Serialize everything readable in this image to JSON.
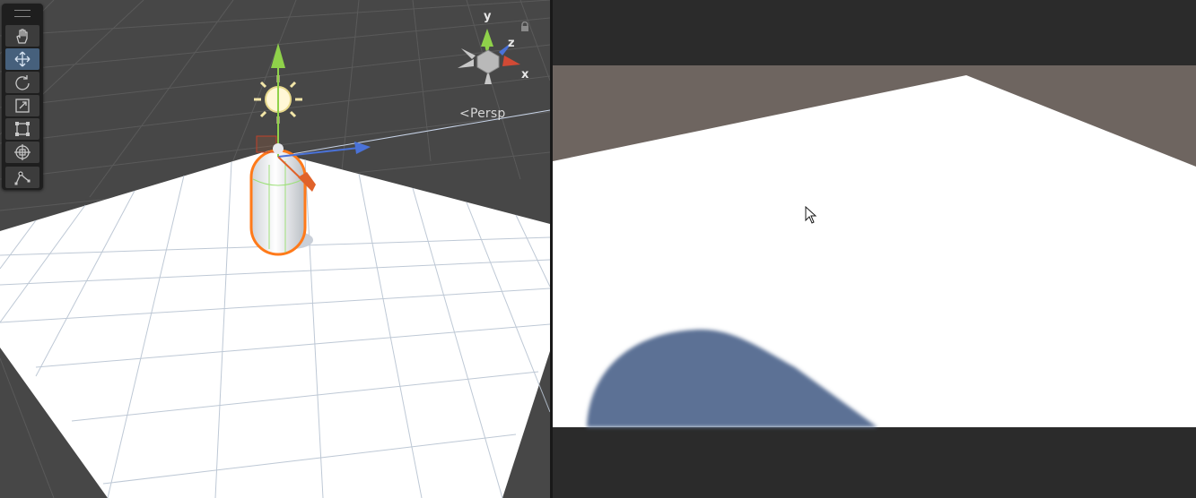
{
  "scene_view": {
    "tools": [
      {
        "name": "hand-tool",
        "active": false
      },
      {
        "name": "move-tool",
        "active": true
      },
      {
        "name": "rotate-tool",
        "active": false
      },
      {
        "name": "scale-tool",
        "active": false
      },
      {
        "name": "rect-tool",
        "active": false
      },
      {
        "name": "transform-tool",
        "active": false
      },
      {
        "name": "custom-tool",
        "active": false
      }
    ],
    "camera_mode": "Persp",
    "gizmo": {
      "y_label": "y",
      "z_label": "z",
      "x_label": "x"
    },
    "colors": {
      "background": "#474747",
      "ground": "#ffffff",
      "selection_outline": "#ff7a1a",
      "axis_x": "#e0622a",
      "axis_y": "#8fd14a",
      "axis_z": "#4a72d8",
      "active_tool": "#46607c"
    }
  },
  "game_view": {
    "colors": {
      "letterbox": "#2b2b2b",
      "sky": "#6e6560",
      "ground": "#ffffff",
      "shadow": "#5b7195"
    }
  }
}
